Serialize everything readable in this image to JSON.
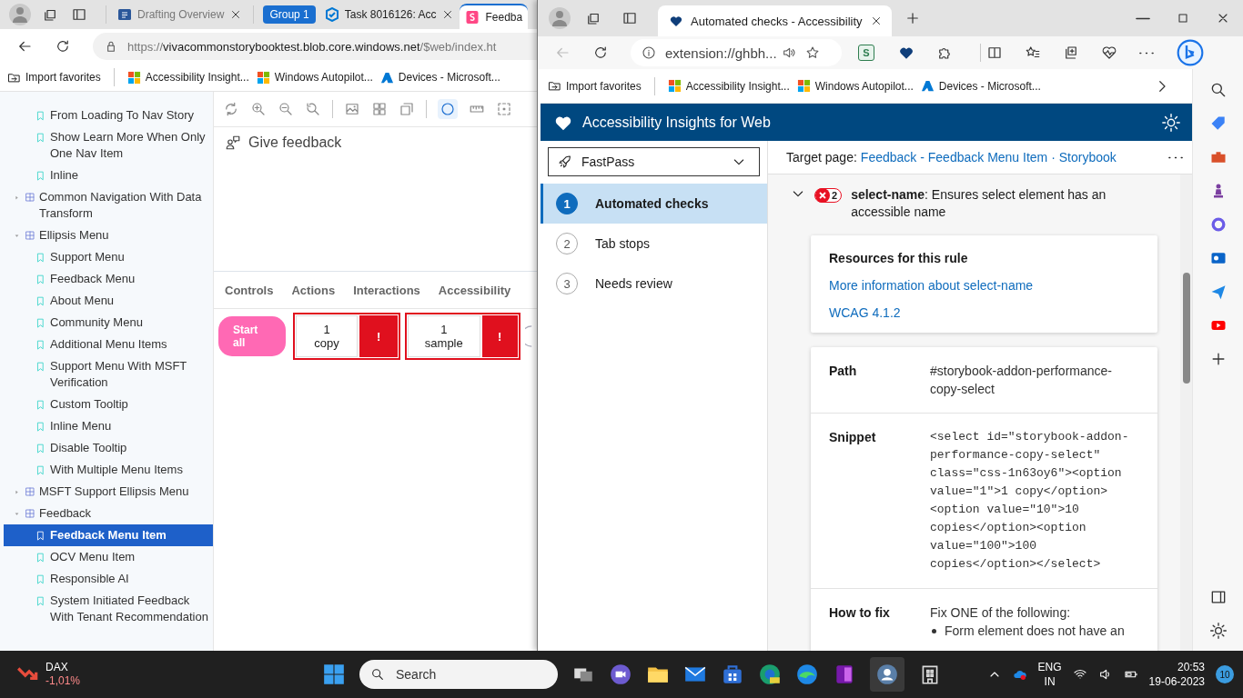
{
  "left_window": {
    "tabs": [
      {
        "title": "Drafting Overview",
        "kind": "word",
        "selected": false
      },
      {
        "title": "Task 8016126: Acc",
        "kind": "task",
        "selected": false,
        "group": "Group 1"
      },
      {
        "title": "Feedba",
        "kind": "storybook",
        "selected": true
      }
    ],
    "address": {
      "scheme": "https://",
      "host": "vivacommonstorybooktest.blob.core.windows.net",
      "path": "/$web/index.ht"
    },
    "favorites": [
      {
        "label": "Import favorites",
        "kind": "import"
      },
      {
        "label": "Accessibility Insight...",
        "kind": "windows"
      },
      {
        "label": "Windows Autopilot...",
        "kind": "windows"
      },
      {
        "label": "Devices - Microsoft...",
        "kind": "azure"
      }
    ],
    "sidebar": [
      {
        "label": "From Loading To Nav Story",
        "kind": "story",
        "selected": false
      },
      {
        "label": "Show Learn More When Only One Nav Item",
        "kind": "story",
        "selected": false
      },
      {
        "label": "Inline",
        "kind": "story",
        "selected": false
      },
      {
        "label": "Common Navigation With Data Transform",
        "kind": "component",
        "selected": false,
        "expanded": false
      },
      {
        "label": "Ellipsis Menu",
        "kind": "component",
        "selected": false,
        "expanded": true,
        "children": [
          {
            "label": "Support Menu",
            "kind": "story",
            "selected": false
          },
          {
            "label": "Feedback Menu",
            "kind": "story",
            "selected": false
          },
          {
            "label": "About Menu",
            "kind": "story",
            "selected": false
          },
          {
            "label": "Community Menu",
            "kind": "story",
            "selected": false
          },
          {
            "label": "Additional Menu Items",
            "kind": "story",
            "selected": false
          },
          {
            "label": "Support Menu With MSFT Verification",
            "kind": "story",
            "selected": false
          },
          {
            "label": "Custom Tooltip",
            "kind": "story",
            "selected": false
          },
          {
            "label": "Inline Menu",
            "kind": "story",
            "selected": false
          },
          {
            "label": "Disable Tooltip",
            "kind": "story",
            "selected": false
          },
          {
            "label": "With Multiple Menu Items",
            "kind": "story",
            "selected": false
          }
        ]
      },
      {
        "label": "MSFT Support Ellipsis Menu",
        "kind": "component",
        "selected": false,
        "expanded": false
      },
      {
        "label": "Feedback",
        "kind": "component",
        "selected": false,
        "expanded": true,
        "children": [
          {
            "label": "Feedback Menu Item",
            "kind": "story",
            "selected": true
          },
          {
            "label": "OCV Menu Item",
            "kind": "story",
            "selected": false
          },
          {
            "label": "Responsible AI",
            "kind": "story",
            "selected": false
          },
          {
            "label": "System Initiated Feedback With Tenant Recommendation",
            "kind": "story",
            "selected": false
          }
        ]
      }
    ],
    "canvas": {
      "give_feedback": "Give feedback"
    },
    "addon_tabs": [
      "Controls",
      "Actions",
      "Interactions",
      "Accessibility"
    ],
    "start_all": "Start all",
    "metrics": [
      {
        "value": "1 copy",
        "alert": "!"
      },
      {
        "value": "1 sample",
        "alert": "!"
      }
    ]
  },
  "right_window": {
    "tab": {
      "title": "Automated checks - Accessibility"
    },
    "address": "extension://ghbh...",
    "extension_label": "S",
    "favorites": [
      {
        "label": "Import favorites",
        "kind": "import"
      },
      {
        "label": "Accessibility Insight...",
        "kind": "windows"
      },
      {
        "label": "Windows Autopilot...",
        "kind": "windows"
      },
      {
        "label": "Devices - Microsoft...",
        "kind": "azure"
      }
    ],
    "panel": {
      "title": "Accessibility Insights for Web",
      "mode": "FastPass",
      "nav": [
        {
          "number": "1",
          "label": "Automated checks",
          "selected": true
        },
        {
          "number": "2",
          "label": "Tab stops",
          "selected": false
        },
        {
          "number": "3",
          "label": "Needs review",
          "selected": false
        }
      ],
      "target_label": "Target page:",
      "target_link": "Feedback - Feedback Menu Item · Storybook",
      "rule": {
        "expanded": true,
        "count": "2",
        "text": "**select-name**: Ensures select element has an accessible name"
      },
      "resources": {
        "heading": "Resources for this rule",
        "links": [
          "More information about select-name",
          "WCAG 4.1.2"
        ]
      },
      "details": [
        {
          "label": "Path",
          "kind": "text",
          "value": "#storybook-addon-performance-copy-select"
        },
        {
          "label": "Snippet",
          "kind": "code",
          "value": "<select id=\"storybook-addon-performance-copy-select\" class=\"css-1n63oy6\"><option value=\"1\">1 copy</option><option value=\"10\">10 copies</option><option value=\"100\">100 copies</option></select>"
        },
        {
          "label": "How to fix",
          "kind": "list",
          "value": "Fix ONE of the following:",
          "items": [
            "Form element does not have an"
          ]
        }
      ]
    }
  },
  "taskbar": {
    "ticker": "DAX",
    "change": "-1,01%",
    "search": "Search",
    "language": "ENG",
    "region": "IN",
    "time": "20:53",
    "date": "19-06-2023",
    "notifications": "10"
  }
}
